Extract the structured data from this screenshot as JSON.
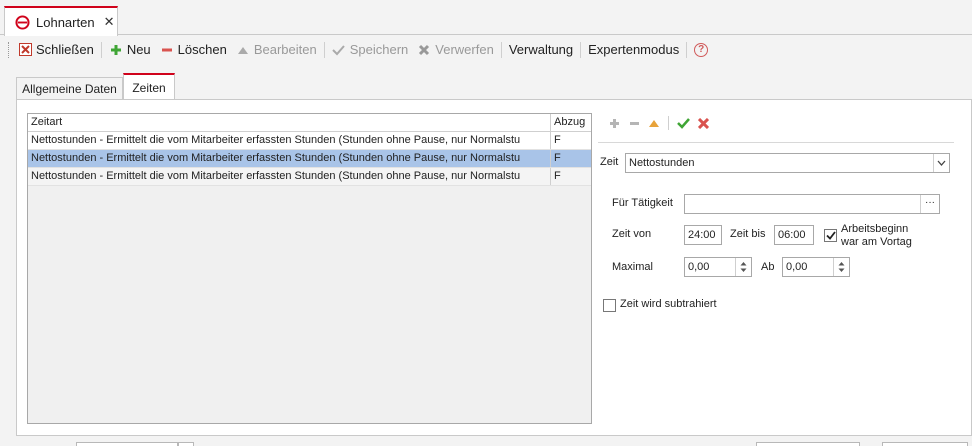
{
  "doc_tab": {
    "title": "Lohnarten",
    "close": "✕"
  },
  "toolbar": {
    "close_label": "Schließen",
    "new_label": "Neu",
    "delete_label": "Löschen",
    "edit_label": "Bearbeiten",
    "save_label": "Speichern",
    "discard_label": "Verwerfen",
    "admin_label": "Verwaltung",
    "expert_label": "Expertenmodus",
    "help_label": "?"
  },
  "subtabs": [
    "Allgemeine Daten",
    "Zeiten"
  ],
  "grid": {
    "columns": [
      "Zeitart",
      "Abzug"
    ],
    "rows": [
      {
        "zeitart": "Nettostunden - Ermittelt die vom Mitarbeiter erfassten Stunden (Stunden ohne Pause, nur Normalstu",
        "abzug": "F"
      },
      {
        "zeitart": "Nettostunden - Ermittelt die vom Mitarbeiter erfassten Stunden (Stunden ohne Pause, nur Normalstu",
        "abzug": "F"
      },
      {
        "zeitart": "Nettostunden - Ermittelt die vom Mitarbeiter erfassten Stunden (Stunden ohne Pause, nur Normalstu",
        "abzug": "F"
      }
    ]
  },
  "form": {
    "zeit_label": "Zeit",
    "zeit_value": "Nettostunden",
    "fuer_taetigkeit_label": "Für Tätigkeit",
    "fuer_taetigkeit_value": "",
    "zeit_von_label": "Zeit von",
    "zeit_von_value": "24:00",
    "zeit_bis_label": "Zeit bis",
    "zeit_bis_value": "06:00",
    "arbeitsbeginn_label_1": "Arbeitsbeginn",
    "arbeitsbeginn_label_2": "war am Vortag",
    "arbeitsbeginn_checked": true,
    "maximal_label": "Maximal",
    "maximal_value": "0,00",
    "ab_label": "Ab",
    "ab_value": "0,00",
    "subtrahiert_label": "Zeit wird subtrahiert",
    "subtrahiert_checked": false
  },
  "colors": {
    "accent": "#d0021b",
    "selection": "#a9c4e8",
    "add_green": "#3fa535",
    "remove_red": "#d9534f"
  }
}
